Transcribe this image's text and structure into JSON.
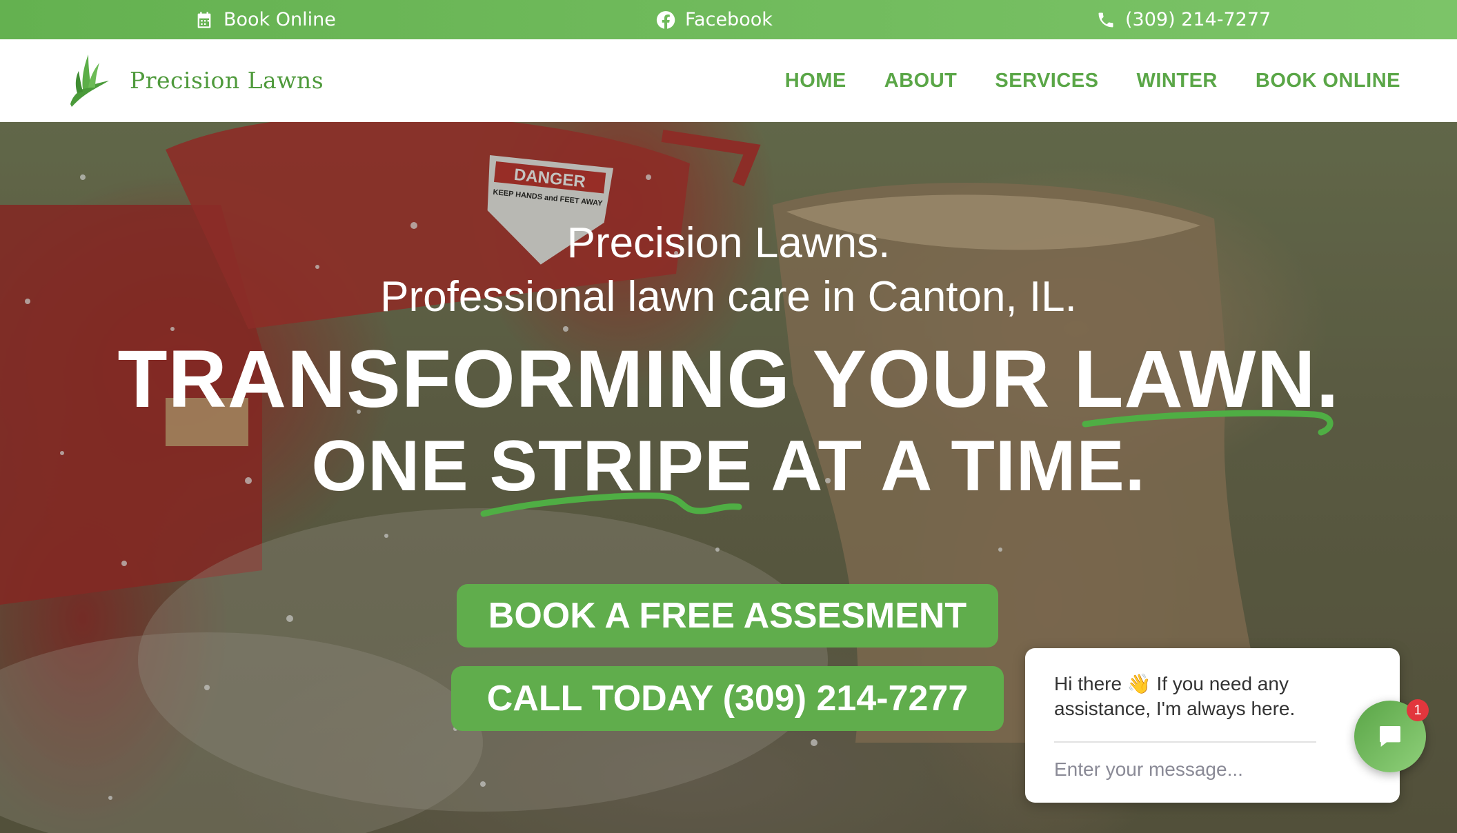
{
  "topbar": {
    "book_online": "Book Online",
    "facebook": "Facebook",
    "phone": "(309) 214-7277"
  },
  "header": {
    "logo_text": "Precision Lawns",
    "nav": [
      "HOME",
      "ABOUT",
      "SERVICES",
      "WINTER",
      "BOOK ONLINE"
    ]
  },
  "hero": {
    "sub1": "Precision Lawns.",
    "sub2": "Professional lawn care in Canton, IL.",
    "head1": "TRANSFORMING YOUR LAWN.",
    "head2": "ONE STRIPE AT A TIME.",
    "cta_book": "BOOK A FREE ASSESMENT",
    "cta_call": "CALL TODAY (309) 214-7277",
    "danger_sign": "DANGER",
    "danger_sub": "KEEP HANDS and FEET AWAY"
  },
  "chat": {
    "message": "Hi there 👋 If you need any assistance, I'm always here.",
    "placeholder": "Enter your message...",
    "badge": "1"
  },
  "colors": {
    "brand_green": "#60ad4c",
    "nav_green": "#5aa647",
    "badge_red": "#e2363d"
  }
}
